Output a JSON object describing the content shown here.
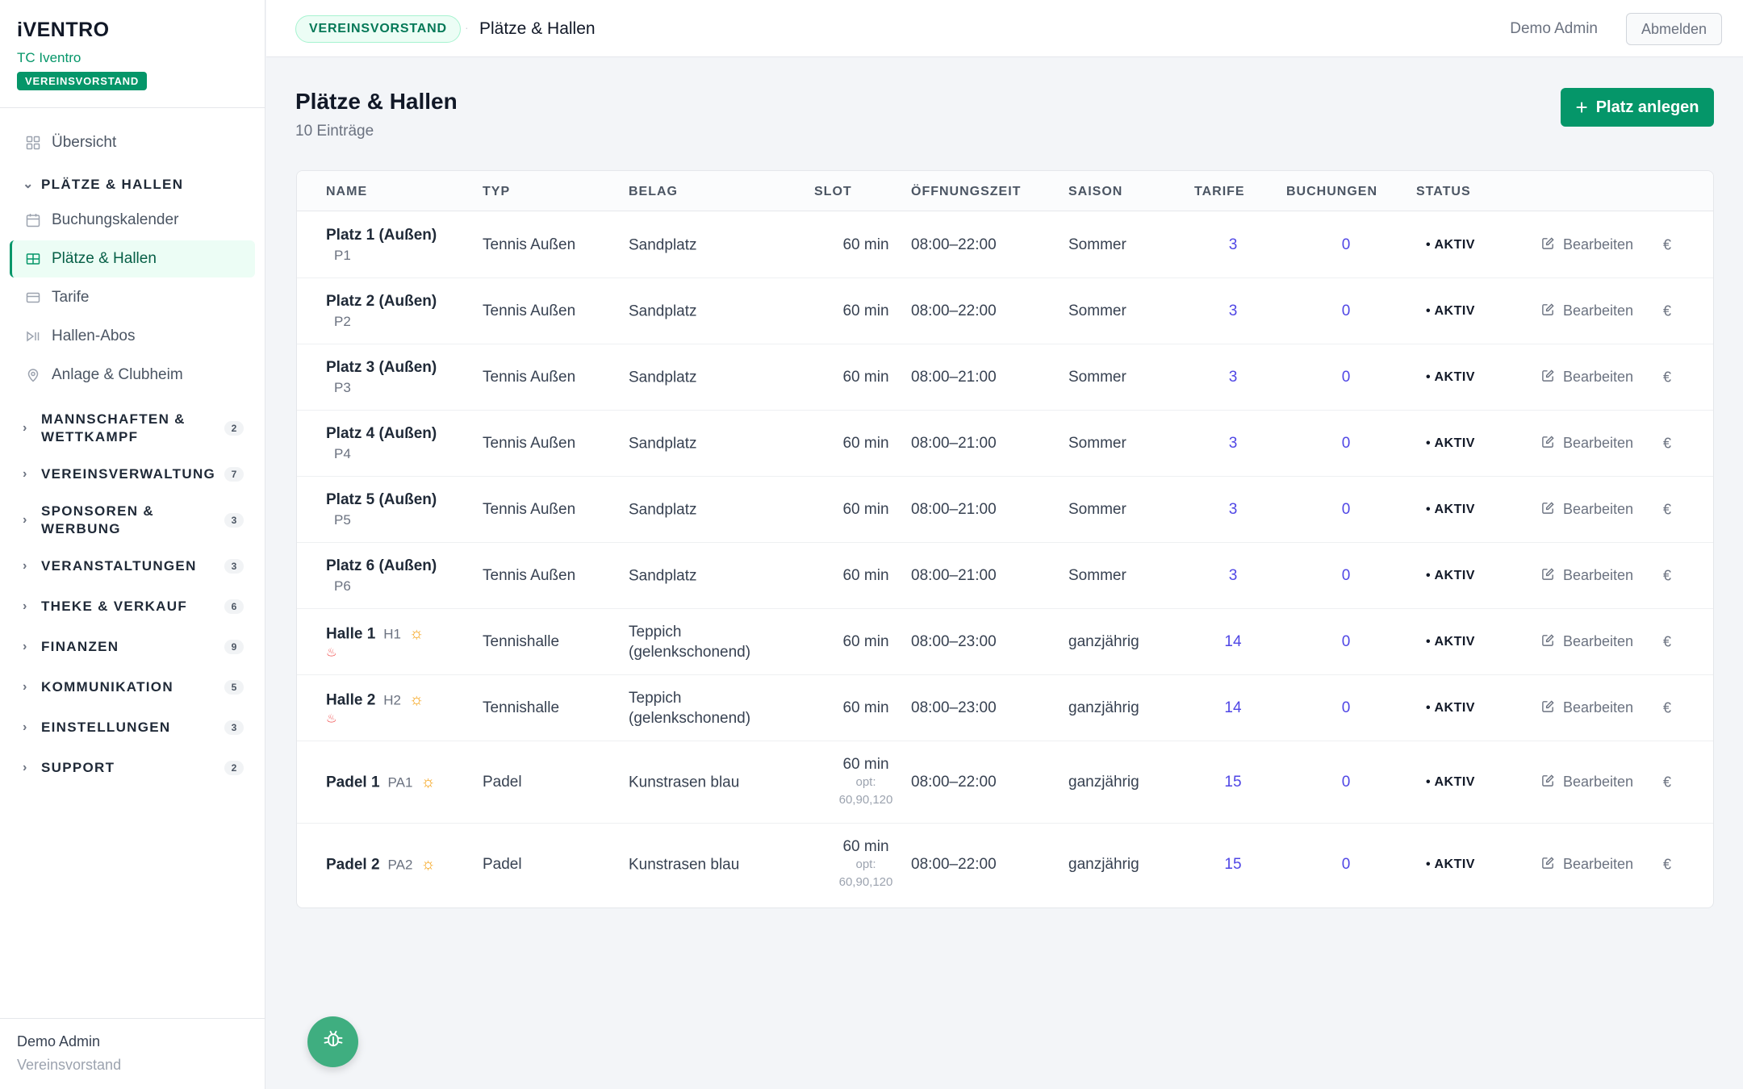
{
  "brand": {
    "logo": "iVENTRO",
    "club": "TC Iventro",
    "role_badge": "VEREINSVORSTAND"
  },
  "sidebar": {
    "overview": {
      "label": "Übersicht",
      "icon": "grid-icon"
    },
    "group_open": {
      "label": "PLÄTZE & HALLEN"
    },
    "sub_items": [
      {
        "label": "Buchungskalender",
        "icon": "calendar-icon"
      },
      {
        "label": "Plätze & Hallen",
        "icon": "table-grid-icon",
        "active": true
      },
      {
        "label": "Tarife",
        "icon": "card-icon"
      },
      {
        "label": "Hallen-Abos",
        "icon": "play-pause-icon"
      },
      {
        "label": "Anlage & Clubheim",
        "icon": "location-pin-icon"
      }
    ],
    "groups": [
      {
        "label": "MANNSCHAFTEN &",
        "label2": "WETTKAMPF",
        "count": "2"
      },
      {
        "label": "VEREINSVERWALTUNG",
        "count": "7"
      },
      {
        "label": "SPONSOREN &",
        "label2": "WERBUNG",
        "count": "3"
      },
      {
        "label": "VERANSTALTUNGEN",
        "count": "3"
      },
      {
        "label": "THEKE & VERKAUF",
        "count": "6"
      },
      {
        "label": "FINANZEN",
        "count": "9"
      },
      {
        "label": "KOMMUNIKATION",
        "count": "5"
      },
      {
        "label": "EINSTELLUNGEN",
        "count": "3"
      },
      {
        "label": "SUPPORT",
        "count": "2"
      }
    ],
    "footer": {
      "name": "Demo Admin",
      "role": "Vereinsvorstand"
    }
  },
  "topbar": {
    "badge": "VEREINSVORSTAND",
    "title": "Plätze & Hallen",
    "user": "Demo Admin",
    "logout": "Abmelden"
  },
  "page": {
    "title": "Plätze & Hallen",
    "subtitle": "10 Einträge",
    "add_button": "Platz anlegen"
  },
  "table": {
    "headers": {
      "name": "NAME",
      "typ": "TYP",
      "belag": "BELAG",
      "slot": "SLOT",
      "open": "ÖFFNUNGSZEIT",
      "season": "SAISON",
      "tarife": "TARIFE",
      "buchungen": "BUCHUNGEN",
      "status": "STATUS"
    },
    "edit_label": "Bearbeiten",
    "euro": "€",
    "rows": [
      {
        "name": "Platz 1 (Außen)",
        "code": "P1",
        "typ": "Tennis Außen",
        "belag": "Sandplatz",
        "belag2": "",
        "slot": "60 min",
        "slot_opt_label": "",
        "slot_opt_values": "",
        "open": "08:00–22:00",
        "season": "Sommer",
        "tarife": "3",
        "buchungen": "0",
        "status": "• AKTIV"
      },
      {
        "name": "Platz 2 (Außen)",
        "code": "P2",
        "typ": "Tennis Außen",
        "belag": "Sandplatz",
        "belag2": "",
        "slot": "60 min",
        "slot_opt_label": "",
        "slot_opt_values": "",
        "open": "08:00–22:00",
        "season": "Sommer",
        "tarife": "3",
        "buchungen": "0",
        "status": "• AKTIV"
      },
      {
        "name": "Platz 3 (Außen)",
        "code": "P3",
        "typ": "Tennis Außen",
        "belag": "Sandplatz",
        "belag2": "",
        "slot": "60 min",
        "slot_opt_label": "",
        "slot_opt_values": "",
        "open": "08:00–21:00",
        "season": "Sommer",
        "tarife": "3",
        "buchungen": "0",
        "status": "• AKTIV"
      },
      {
        "name": "Platz 4 (Außen)",
        "code": "P4",
        "typ": "Tennis Außen",
        "belag": "Sandplatz",
        "belag2": "",
        "slot": "60 min",
        "slot_opt_label": "",
        "slot_opt_values": "",
        "open": "08:00–21:00",
        "season": "Sommer",
        "tarife": "3",
        "buchungen": "0",
        "status": "• AKTIV"
      },
      {
        "name": "Platz 5 (Außen)",
        "code": "P5",
        "typ": "Tennis Außen",
        "belag": "Sandplatz",
        "belag2": "",
        "slot": "60 min",
        "slot_opt_label": "",
        "slot_opt_values": "",
        "open": "08:00–21:00",
        "season": "Sommer",
        "tarife": "3",
        "buchungen": "0",
        "status": "• AKTIV"
      },
      {
        "name": "Platz 6 (Außen)",
        "code": "P6",
        "typ": "Tennis Außen",
        "belag": "Sandplatz",
        "belag2": "",
        "slot": "60 min",
        "slot_opt_label": "",
        "slot_opt_values": "",
        "open": "08:00–21:00",
        "season": "Sommer",
        "tarife": "3",
        "buchungen": "0",
        "status": "• AKTIV"
      },
      {
        "name": "Halle 1",
        "code": "H1",
        "typ": "Tennishalle",
        "belag": "Teppich",
        "belag2": "(gelenkschonend)",
        "slot": "60 min",
        "slot_opt_label": "",
        "slot_opt_values": "",
        "open": "08:00–23:00",
        "season": "ganzjährig",
        "tarife": "14",
        "buchungen": "0",
        "status": "• AKTIV"
      },
      {
        "name": "Halle 2",
        "code": "H2",
        "typ": "Tennishalle",
        "belag": "Teppich",
        "belag2": "(gelenkschonend)",
        "slot": "60 min",
        "slot_opt_label": "",
        "slot_opt_values": "",
        "open": "08:00–23:00",
        "season": "ganzjährig",
        "tarife": "14",
        "buchungen": "0",
        "status": "• AKTIV"
      },
      {
        "name": "Padel 1",
        "code": "PA1",
        "typ": "Padel",
        "belag": "Kunstrasen blau",
        "belag2": "",
        "slot": "60 min",
        "slot_opt_label": "opt:",
        "slot_opt_values": "60,90,120",
        "open": "08:00–22:00",
        "season": "ganzjährig",
        "tarife": "15",
        "buchungen": "0",
        "status": "• AKTIV"
      },
      {
        "name": "Padel 2",
        "code": "PA2",
        "typ": "Padel",
        "belag": "Kunstrasen blau",
        "belag2": "",
        "slot": "60 min",
        "slot_opt_label": "opt:",
        "slot_opt_values": "60,90,120",
        "open": "08:00–22:00",
        "season": "ganzjährig",
        "tarife": "15",
        "buchungen": "0",
        "status": "• AKTIV"
      }
    ]
  },
  "colors": {
    "accent": "#059669",
    "link": "#4f46e5",
    "sun": "#f59e0b",
    "heat": "#ef4444"
  }
}
